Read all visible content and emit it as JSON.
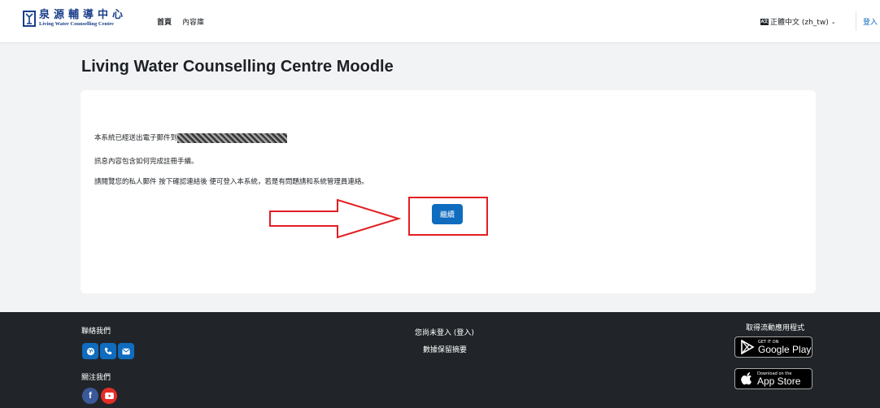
{
  "header": {
    "logo_cn": "泉源輔導中心",
    "logo_en": "Living Water Counselling Centre",
    "nav": [
      "首頁",
      "內容庫"
    ],
    "language": "正體中文 (zh_tw)",
    "login": "登入"
  },
  "main": {
    "title": "Living Water Counselling Centre Moodle",
    "message_prefix": "本系統已經送出電子郵件到",
    "message_line2": "訊息內容包含如何完成註冊手續。",
    "message_line3": "請閱覽您的私人郵件 按下確認連結後 便可登入本系統，若是有問題請和系統管理員連絡。",
    "continue_button": "繼續"
  },
  "footer": {
    "contact_label": "聯絡我們",
    "follow_label": "關注我們",
    "not_logged_in": "您尚未登入 (登入)",
    "data_retention": "數據保留摘要",
    "get_app": "取得流動應用程式",
    "google_play_small": "GET IT ON",
    "google_play_big": "Google Play",
    "app_store_small": "Download on the",
    "app_store_big": "App Store"
  },
  "colors": {
    "primary": "#0f6cbf",
    "annotation_red": "#e31e24",
    "footer_bg": "#212529",
    "youtube_red": "#e52d27"
  }
}
